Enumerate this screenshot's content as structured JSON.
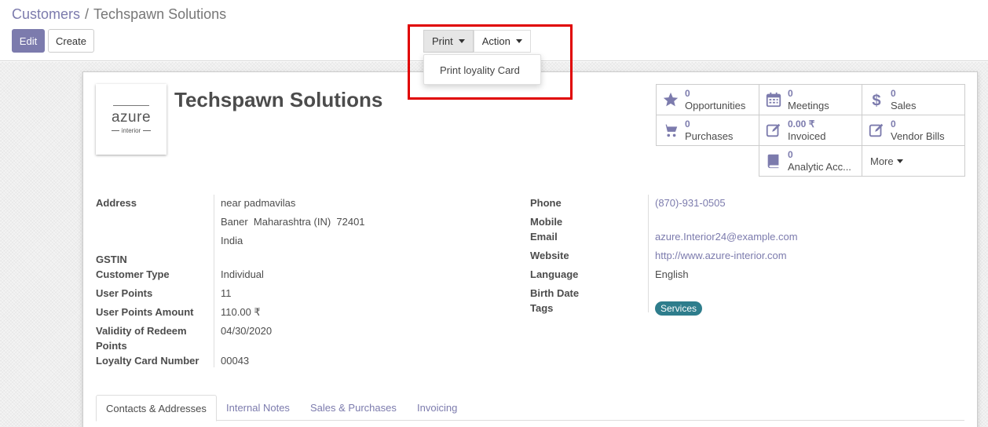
{
  "breadcrumb": {
    "parent": "Customers",
    "separator": "/",
    "current": "Techspawn Solutions"
  },
  "buttons": {
    "edit": "Edit",
    "create": "Create"
  },
  "sidebar": {
    "print": "Print",
    "action": "Action",
    "print_menu_items": [
      "Print loyality Card"
    ]
  },
  "colors": {
    "accent": "#7c7bad",
    "highlight": "#e00000",
    "tag": "#2e7d8c"
  },
  "partner": {
    "name": "Techspawn Solutions",
    "logo": {
      "text": "azure",
      "subtext": "interior"
    }
  },
  "stats": [
    {
      "value": "0",
      "label": "Opportunities",
      "icon": "star-icon"
    },
    {
      "value": "0",
      "label": "Meetings",
      "icon": "calendar-icon"
    },
    {
      "value": "0",
      "label": "Sales",
      "icon": "dollar-icon"
    },
    {
      "value": "0",
      "label": "Purchases",
      "icon": "cart-icon"
    },
    {
      "value": "0.00 ₹",
      "label": "Invoiced",
      "icon": "edit-icon"
    },
    {
      "value": "0",
      "label": "Vendor Bills",
      "icon": "edit-icon"
    },
    {
      "value": "0",
      "label": "Analytic Acc...",
      "icon": "book-icon"
    }
  ],
  "more_label": "More",
  "fields_left": {
    "address_label": "Address",
    "address_lines": [
      "near padmavilas",
      "Baner  Maharashtra (IN)  72401",
      "India"
    ],
    "gstin_label": "GSTIN",
    "customer_type_label": "Customer Type",
    "customer_type": "Individual",
    "user_points_label": "User Points",
    "user_points": "11",
    "user_points_amount_label": "User Points Amount",
    "user_points_amount": "110.00 ₹",
    "validity_label_1": "Validity of Redeem",
    "validity_label_2": "Points",
    "validity": "04/30/2020",
    "loyalty_card_label": "Loyalty Card Number",
    "loyalty_card": "00043"
  },
  "fields_right": {
    "phone_label": "Phone",
    "phone": "(870)-931-0505",
    "mobile_label": "Mobile",
    "email_label": "Email",
    "email": "azure.Interior24@example.com",
    "website_label": "Website",
    "website": "http://www.azure-interior.com",
    "language_label": "Language",
    "language": "English",
    "birth_date_label": "Birth Date",
    "tags_label": "Tags",
    "tags": [
      "Services"
    ]
  },
  "tabs": [
    "Contacts & Addresses",
    "Internal Notes",
    "Sales & Purchases",
    "Invoicing"
  ]
}
